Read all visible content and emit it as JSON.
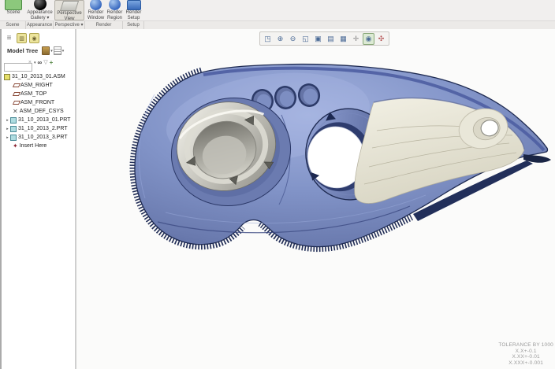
{
  "ribbon": {
    "buttons": [
      {
        "line1": "Scene",
        "line2": ""
      },
      {
        "line1": "Appearance",
        "line2": "Gallery ▾"
      },
      {
        "line1": "Perspective",
        "line2": "View"
      },
      {
        "line1": "Render",
        "line2": "Window"
      },
      {
        "line1": "Render",
        "line2": "Region"
      },
      {
        "line1": "Render",
        "line2": "Setup"
      }
    ],
    "groups": [
      "Scene",
      "Appearance",
      "Perspective ▾",
      "Render",
      "Setup"
    ]
  },
  "gtoolbar": {
    "buttons": [
      {
        "name": "zoom-region",
        "glyph": "◳"
      },
      {
        "name": "zoom-in",
        "glyph": "⊕"
      },
      {
        "name": "zoom-out",
        "glyph": "⊖"
      },
      {
        "name": "refit",
        "glyph": "◱"
      },
      {
        "name": "repaint",
        "glyph": "▣"
      },
      {
        "name": "saved-views",
        "glyph": "▤"
      },
      {
        "name": "display-style",
        "glyph": "▦"
      },
      {
        "name": "datum-display",
        "glyph": "✛"
      },
      {
        "name": "annotation-display",
        "glyph": "◉"
      },
      {
        "name": "spin-center",
        "glyph": "✣"
      }
    ]
  },
  "navigator": {
    "tabs": [
      {
        "name": "model-tree-tab",
        "glyph": "≡"
      },
      {
        "name": "folder-browser-tab",
        "glyph": "▥"
      },
      {
        "name": "favorites-tab",
        "glyph": "◉"
      }
    ],
    "header": {
      "title": "Model Tree"
    },
    "search": {
      "value": "",
      "clear_glyph": "×",
      "find_glyph": "∞",
      "filter_glyph": "▽",
      "add_glyph": "+"
    }
  },
  "tree": {
    "items": [
      {
        "label": "31_10_2013_01.ASM",
        "icon": "assembly"
      },
      {
        "label": "ASM_RIGHT",
        "icon": "datum-plane"
      },
      {
        "label": "ASM_TOP",
        "icon": "datum-plane"
      },
      {
        "label": "ASM_FRONT",
        "icon": "datum-plane"
      },
      {
        "label": "ASM_DEF_CSYS",
        "icon": "csys"
      },
      {
        "label": "31_10_2013_01.PRT",
        "icon": "part",
        "expandable": true
      },
      {
        "label": "31_10_2013_2.PRT",
        "icon": "part",
        "expandable": true
      },
      {
        "label": "31_10_2013_3.PRT",
        "icon": "part",
        "expandable": true
      },
      {
        "label": "Insert Here",
        "icon": "insert"
      }
    ],
    "csys_glyph": "✕",
    "insert_glyph": "✦",
    "expand_glyph": "▸"
  },
  "viewport": {
    "tolerance_note": [
      "TOLERANCE BY 1000",
      "X.X+-0.1",
      "X.XX+-0.01",
      "X.XXX+-0.001"
    ],
    "model_colors": {
      "body_blue": "#8094c8",
      "edge_navy": "#1f2b52",
      "ring_gray": "#c9c8c0",
      "recess_cream": "#e9e7d9"
    }
  }
}
